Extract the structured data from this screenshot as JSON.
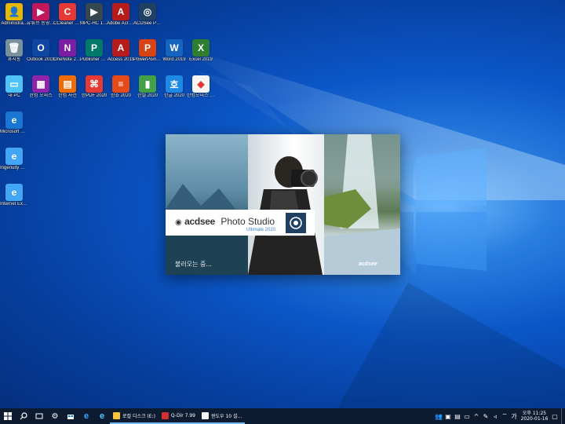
{
  "desktop": {
    "icons": [
      {
        "label": "Administra...",
        "color": "#e6b800",
        "glyph": "👤"
      },
      {
        "label": "유튜브 동영상 다운로더",
        "color": "#c2185b",
        "glyph": "▶"
      },
      {
        "label": "CCleaner Pro 5.63",
        "color": "#e53935",
        "glyph": "C"
      },
      {
        "label": "MPC-HC 1.9.0",
        "color": "#37474f",
        "glyph": "▶"
      },
      {
        "label": "Adobe Acrobat DC",
        "color": "#b71c1c",
        "glyph": "A"
      },
      {
        "label": "ACDSee Photo Stu...",
        "color": "#1f3f63",
        "glyph": "◎"
      },
      {
        "label": "휴지통",
        "color": "#78909c",
        "glyph": "🗑"
      },
      {
        "label": "Outlook 2019",
        "color": "#0d47a1",
        "glyph": "O"
      },
      {
        "label": "OneNote 2019",
        "color": "#7b1fa2",
        "glyph": "N"
      },
      {
        "label": "Publisher 2019",
        "color": "#00796b",
        "glyph": "P"
      },
      {
        "label": "Access 2019",
        "color": "#b71c1c",
        "glyph": "A"
      },
      {
        "label": "PowerPoint 2019",
        "color": "#d84315",
        "glyph": "P"
      },
      {
        "label": "Word 2019",
        "color": "#1565c0",
        "glyph": "W"
      },
      {
        "label": "Excel 2019",
        "color": "#2e7d32",
        "glyph": "X"
      },
      {
        "label": "내 PC",
        "color": "#4fc3f7",
        "glyph": "▭"
      },
      {
        "label": "한컴 오피스",
        "color": "#8e24aa",
        "glyph": "▦"
      },
      {
        "label": "한컴 사전",
        "color": "#ef6c00",
        "glyph": "▤"
      },
      {
        "label": "한PDF 2020",
        "color": "#e53935",
        "glyph": "⌘"
      },
      {
        "label": "한쇼 2020",
        "color": "#e64a19",
        "glyph": "≡"
      },
      {
        "label": "한셀 2020",
        "color": "#43a047",
        "glyph": "▮"
      },
      {
        "label": "한글 2020",
        "color": "#1e88e5",
        "glyph": "호"
      },
      {
        "label": "한컴오피스 2020",
        "color": "#f5f5f5",
        "glyph": "◆"
      },
      {
        "label": "Microsoft Edge",
        "color": "#1976d2",
        "glyph": "e"
      },
      {
        "label": "Ingenuity 업로드",
        "color": "#42a5f5",
        "glyph": "e"
      },
      {
        "label": "Internet Explorer",
        "color": "#42a5f5",
        "glyph": "e"
      }
    ]
  },
  "splash": {
    "brand_bold": "acdsee",
    "product": "Photo Studio",
    "edition": "Ultimate 2020",
    "loading": "불러오는 중...",
    "footer_brand": "acdsee"
  },
  "taskbar": {
    "start_icon": "start-icon",
    "apps": [
      {
        "label": "로컬 디스크 (E:)",
        "color": "#f6c342"
      },
      {
        "label": "Q-Dir 7.99",
        "color": "#d32f2f"
      },
      {
        "label": "윈도우 10 설...",
        "color": "#f5f5f5"
      }
    ],
    "tray_lang": "가",
    "clock": {
      "ampm_time": "오후 11:25",
      "date": "2020-01-16"
    }
  }
}
